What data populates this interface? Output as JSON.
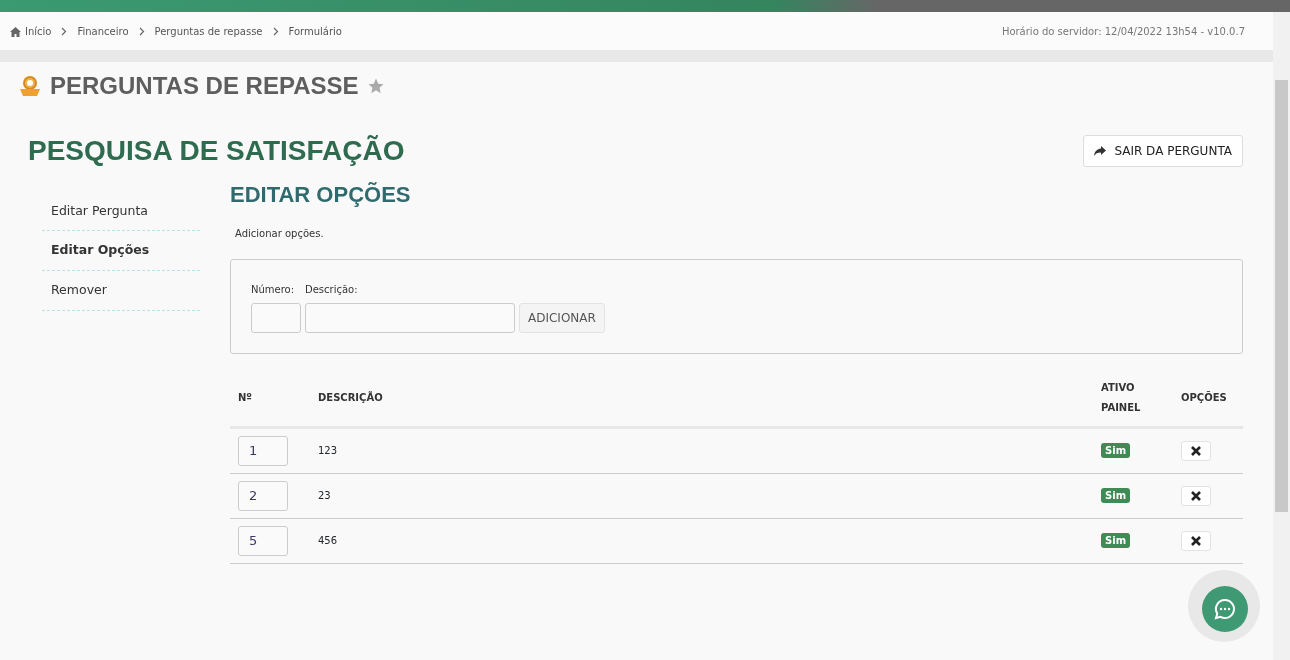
{
  "breadcrumb": [
    {
      "label": "Início",
      "kind": "home"
    },
    {
      "label": "Financeiro",
      "kind": "link"
    },
    {
      "label": "Perguntas de repasse",
      "kind": "link"
    },
    {
      "label": "Formulário",
      "kind": "current"
    }
  ],
  "server_time": "Horário do servidor: 12/04/2022 13h54 - v10.0.7",
  "page_title": "PERGUNTAS DE REPASSE",
  "form_title": "PESQUISA DE SATISFAÇÃO",
  "exit_button": "SAIR DA PERGUNTA",
  "sidebar": {
    "items": [
      {
        "label": "Editar Pergunta",
        "selected": false
      },
      {
        "label": "Editar Opções",
        "selected": true
      },
      {
        "label": "Remover",
        "selected": false
      }
    ]
  },
  "section_title": "EDITAR OPÇÕES",
  "hint": "Adicionar opções.",
  "add_form": {
    "number_label": "Número:",
    "description_label": "Descrição:",
    "button": "ADICIONAR"
  },
  "table": {
    "columns": [
      "Nº",
      "DESCRIÇÃO",
      "ATIVO PAINEL",
      "OPÇÕES"
    ],
    "rows": [
      {
        "number": "1",
        "description": "123",
        "active_panel": "Sim"
      },
      {
        "number": "2",
        "description": "23",
        "active_panel": "Sim"
      },
      {
        "number": "5",
        "description": "456",
        "active_panel": "Sim"
      }
    ]
  }
}
